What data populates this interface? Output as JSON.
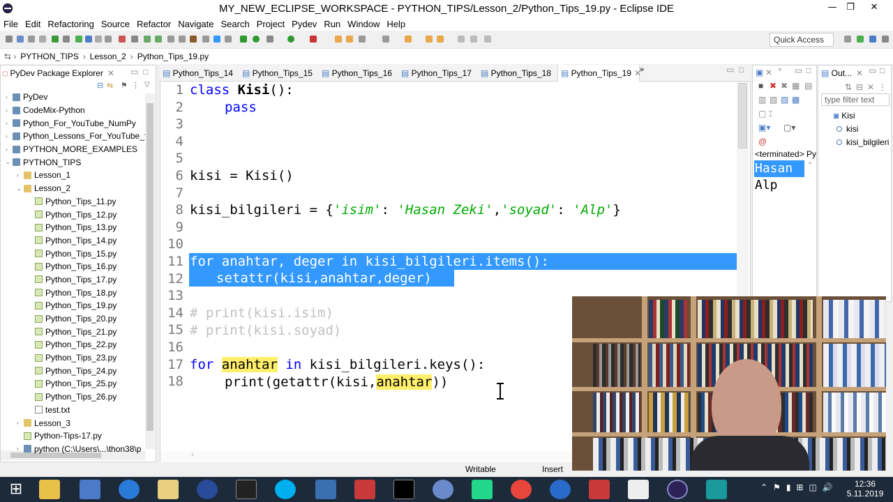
{
  "window": {
    "title": "MY_NEW_ECLIPSE_WORKSPACE - PYTHON_TIPS/Lesson_2/Python_Tips_19.py - Eclipse IDE",
    "minimize": "—",
    "maximize": "❐",
    "close": "✕"
  },
  "menu": [
    "File",
    "Edit",
    "Refactoring",
    "Source",
    "Refactor",
    "Navigate",
    "Search",
    "Project",
    "Pydev",
    "Run",
    "Window",
    "Help"
  ],
  "quick_access": "Quick Access",
  "breadcrumb": [
    "PYTHON_TIPS",
    "Lesson_2",
    "Python_Tips_19.py"
  ],
  "explorer": {
    "title": "PyDev Package Explorer",
    "items": [
      {
        "label": "PyDev",
        "type": "proj",
        "indent": 0,
        "arrow": "›"
      },
      {
        "label": "CodeMix-Python",
        "type": "proj",
        "indent": 0,
        "arrow": "›"
      },
      {
        "label": "Python_For_YouTube_NumPy",
        "type": "proj",
        "indent": 0,
        "arrow": "›"
      },
      {
        "label": "Python_Lessons_For_YouTube_fre",
        "type": "proj",
        "indent": 0,
        "arrow": "›"
      },
      {
        "label": "PYTHON_MORE_EXAMPLES",
        "type": "proj",
        "indent": 0,
        "arrow": "›"
      },
      {
        "label": "PYTHON_TIPS",
        "type": "proj",
        "indent": 0,
        "arrow": "⌄"
      },
      {
        "label": "Lesson_1",
        "type": "folder",
        "indent": 1,
        "arrow": "›"
      },
      {
        "label": "Lesson_2",
        "type": "folder",
        "indent": 1,
        "arrow": "⌄"
      },
      {
        "label": "Python_Tips_11.py",
        "type": "file",
        "indent": 2,
        "arrow": ""
      },
      {
        "label": "Python_Tips_12.py",
        "type": "file",
        "indent": 2,
        "arrow": ""
      },
      {
        "label": "Python_Tips_13.py",
        "type": "file",
        "indent": 2,
        "arrow": ""
      },
      {
        "label": "Python_Tips_14.py",
        "type": "file",
        "indent": 2,
        "arrow": ""
      },
      {
        "label": "Python_Tips_15.py",
        "type": "file",
        "indent": 2,
        "arrow": ""
      },
      {
        "label": "Python_Tips_16.py",
        "type": "file",
        "indent": 2,
        "arrow": ""
      },
      {
        "label": "Python_Tips_17.py",
        "type": "file",
        "indent": 2,
        "arrow": ""
      },
      {
        "label": "Python_Tips_18.py",
        "type": "file",
        "indent": 2,
        "arrow": ""
      },
      {
        "label": "Python_Tips_19.py",
        "type": "file",
        "indent": 2,
        "arrow": ""
      },
      {
        "label": "Python_Tips_20.py",
        "type": "file",
        "indent": 2,
        "arrow": ""
      },
      {
        "label": "Python_Tips_21.py",
        "type": "file",
        "indent": 2,
        "arrow": ""
      },
      {
        "label": "Python_Tips_22.py",
        "type": "file",
        "indent": 2,
        "arrow": ""
      },
      {
        "label": "Python_Tips_23.py",
        "type": "file",
        "indent": 2,
        "arrow": ""
      },
      {
        "label": "Python_Tips_24.py",
        "type": "file",
        "indent": 2,
        "arrow": ""
      },
      {
        "label": "Python_Tips_25.py",
        "type": "file",
        "indent": 2,
        "arrow": ""
      },
      {
        "label": "Python_Tips_26.py",
        "type": "file",
        "indent": 2,
        "arrow": ""
      },
      {
        "label": "test.txt",
        "type": "txt",
        "indent": 2,
        "arrow": ""
      },
      {
        "label": "Lesson_3",
        "type": "folder",
        "indent": 1,
        "arrow": "›"
      },
      {
        "label": "Python-Tips-17.py",
        "type": "file",
        "indent": 1,
        "arrow": ""
      },
      {
        "label": "python  (C:\\Users\\...\\thon38\\p",
        "type": "proj",
        "indent": 1,
        "arrow": "›"
      }
    ]
  },
  "editor_tabs": [
    "Python_Tips_14",
    "Python_Tips_15",
    "Python_Tips_16",
    "Python_Tips_17",
    "Python_Tips_18",
    "Python_Tips_19"
  ],
  "editor_tab_overflow": "»",
  "code": {
    "l1": {
      "kw": "class",
      "name": "Kisi",
      "rest": "():"
    },
    "l2": {
      "kw": "pass"
    },
    "l6": "kisi = Kisi()",
    "l8": {
      "a": "kisi_bilgileri = {",
      "k1": "'isim'",
      "c1": ": ",
      "v1": "'Hasan Zeki'",
      "c2": ",",
      "k2": "'soyad'",
      "c3": ": ",
      "v2": "'Alp'",
      "end": "}"
    },
    "l11": {
      "kw": "for",
      "sel": "anahtar, deger in kisi_bilgileri.items():"
    },
    "l12": {
      "sel": "setattr(kisi,anahtar,deger)"
    },
    "l14": "# print(kisi.isim)",
    "l15": "# print(kisi.soyad)",
    "l17": {
      "kw": "for",
      "var": "anahtar",
      "kw2": "in",
      "rest": "kisi_bilgileri.keys():"
    },
    "l18": {
      "a": "print(getattr(kisi,",
      "var": "anahtar",
      "end": "))"
    }
  },
  "line_numbers": [
    "1",
    "2",
    "3",
    "4",
    "5",
    "6",
    "7",
    "8",
    "9",
    "10",
    "11",
    "12",
    "13",
    "14",
    "15",
    "16",
    "17",
    "18"
  ],
  "console": {
    "terminated": "<terminated> Py",
    "line1": "Hasan",
    "line2": "Alp"
  },
  "outline": {
    "title": "Out...",
    "filter_placeholder": "type filter text",
    "items": [
      "Kisi",
      "kisi",
      "kisi_bilgileri"
    ]
  },
  "status": {
    "mode": "Writable",
    "insert": "Insert"
  },
  "clock": {
    "time": "12:36",
    "date": "5.11.2019"
  }
}
